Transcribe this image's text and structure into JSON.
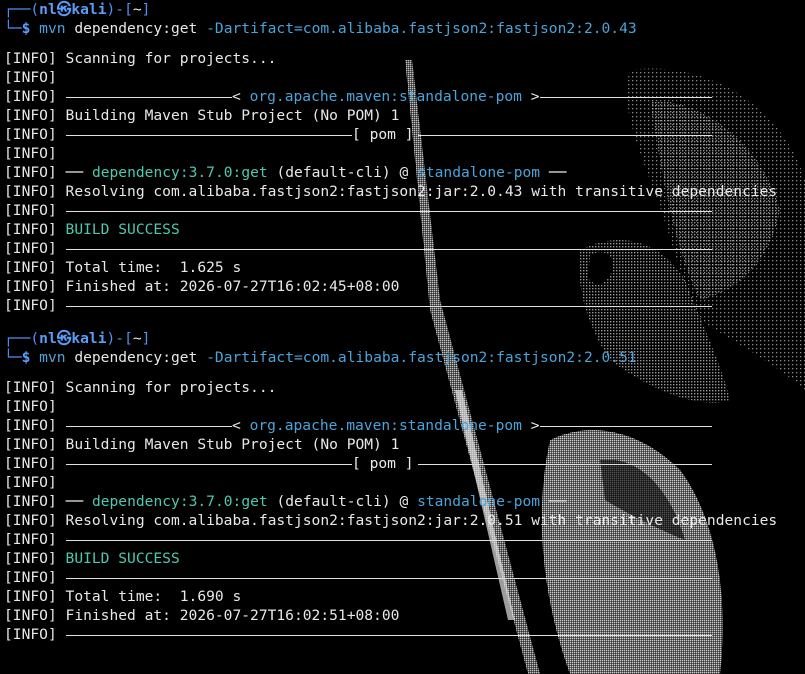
{
  "prompt": {
    "corner_top": "┌──(",
    "user": "nl",
    "skull": "㉿",
    "host": "kali",
    "close": ")-[",
    "dir": "~",
    "end": "]",
    "corner_bottom": "└─",
    "dollar": "$"
  },
  "sessions": [
    {
      "command": "mvn",
      "subcommand": "dependency:get",
      "argument": "-Dartifact=com.alibaba.fastjson2:fastjson2:2.0.43",
      "log": {
        "scanning": "Scanning for projects...",
        "project_banner": "< org.apache.maven:standalone-pom >",
        "building": "Building Maven Stub Project (No POM) 1",
        "packaging": "[ pom ]",
        "plugin": "dependency:3.7.0:get",
        "plugin_mode": "(default-cli) @",
        "plugin_target": "standalone-pom",
        "resolving": "Resolving com.alibaba.fastjson2:fastjson2:jar:2.0.43 with transitive dependencies",
        "result": "BUILD SUCCESS",
        "total_time": "Total time:  1.625 s",
        "finished": "Finished at: 2026-07-27T16:02:45+08:00"
      }
    },
    {
      "command": "mvn",
      "subcommand": "dependency:get",
      "argument": "-Dartifact=com.alibaba.fastjson2:fastjson2:2.0.51",
      "log": {
        "scanning": "Scanning for projects...",
        "project_banner": "< org.apache.maven:standalone-pom >",
        "building": "Building Maven Stub Project (No POM) 1",
        "packaging": "[ pom ]",
        "plugin": "dependency:3.7.0:get",
        "plugin_mode": "(default-cli) @",
        "plugin_target": "standalone-pom",
        "resolving": "Resolving com.alibaba.fastjson2:fastjson2:jar:2.0.51 with transitive dependencies",
        "result": "BUILD SUCCESS",
        "total_time": "Total time:  1.690 s",
        "finished": "Finished at: 2026-07-27T16:02:51+08:00"
      }
    }
  ],
  "info_tag": "INFO",
  "colors": {
    "background": "#000000",
    "prompt_blue": "#4f8ff7",
    "info_blue": "#5b9cf9",
    "link_cyan": "#4aa3d9",
    "success_green": "#4ec9b0",
    "text": "#e8e8e8"
  }
}
